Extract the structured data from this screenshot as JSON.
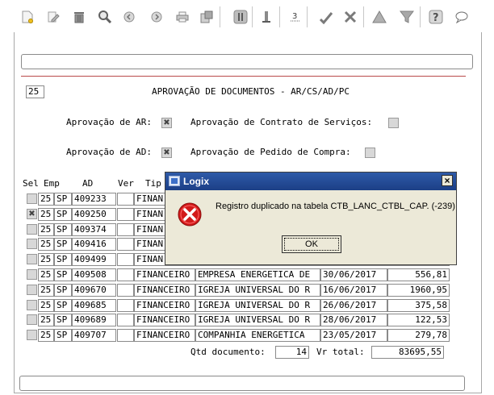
{
  "toolbar": {
    "icons": [
      "new-document-icon",
      "edit-icon",
      "trash-icon",
      "search-icon",
      "previous-icon",
      "next-icon",
      "print-icon",
      "export-icon",
      "first-icon",
      "last-icon",
      "page-icon",
      "approve-icon",
      "tools-icon",
      "warning-icon",
      "filter-icon",
      "help-icon",
      "chat-icon"
    ]
  },
  "form": {
    "code": "25",
    "title": "APROVAÇÃO DE DOCUMENTOS - AR/CS/AD/PC",
    "approval_ar_label": "Aprovação de AR:",
    "approval_ar_checked": true,
    "approval_cs_label": "Aprovação de Contrato de Serviços:",
    "approval_cs_checked": false,
    "approval_ad_label": "Aprovação de AD:",
    "approval_ad_checked": true,
    "approval_pc_label": "Aprovação de Pedido de Compra:",
    "approval_pc_checked": false
  },
  "table": {
    "headers": {
      "sel": "Sel",
      "emp": "Emp",
      "ad": "AD",
      "ver": "Ver",
      "tip": "Tip"
    },
    "rows": [
      {
        "sel": false,
        "emp": "25",
        "uf": "SP",
        "ad": "409233",
        "ver": "",
        "tipo": "FINAN",
        "fornecedor": "",
        "data": "",
        "valor": ""
      },
      {
        "sel": true,
        "emp": "25",
        "uf": "SP",
        "ad": "409250",
        "ver": "",
        "tipo": "FINAN",
        "fornecedor": "",
        "data": "",
        "valor": ""
      },
      {
        "sel": false,
        "emp": "25",
        "uf": "SP",
        "ad": "409374",
        "ver": "",
        "tipo": "FINAN",
        "fornecedor": "",
        "data": "",
        "valor": ""
      },
      {
        "sel": false,
        "emp": "25",
        "uf": "SP",
        "ad": "409416",
        "ver": "",
        "tipo": "FINAN",
        "fornecedor": "",
        "data": "",
        "valor": ""
      },
      {
        "sel": false,
        "emp": "25",
        "uf": "SP",
        "ad": "409499",
        "ver": "",
        "tipo": "FINAN",
        "fornecedor": "",
        "data": "",
        "valor": ""
      },
      {
        "sel": false,
        "emp": "25",
        "uf": "SP",
        "ad": "409508",
        "ver": "",
        "tipo": "FINANCEIRO",
        "fornecedor": "EMPRESA ENERGETICA DE",
        "data": "30/06/2017",
        "valor": "556,81"
      },
      {
        "sel": false,
        "emp": "25",
        "uf": "SP",
        "ad": "409670",
        "ver": "",
        "tipo": "FINANCEIRO",
        "fornecedor": "IGREJA UNIVERSAL DO R",
        "data": "16/06/2017",
        "valor": "1960,95"
      },
      {
        "sel": false,
        "emp": "25",
        "uf": "SP",
        "ad": "409685",
        "ver": "",
        "tipo": "FINANCEIRO",
        "fornecedor": "IGREJA UNIVERSAL DO R",
        "data": "26/06/2017",
        "valor": "375,58"
      },
      {
        "sel": false,
        "emp": "25",
        "uf": "SP",
        "ad": "409689",
        "ver": "",
        "tipo": "FINANCEIRO",
        "fornecedor": "IGREJA UNIVERSAL DO R",
        "data": "28/06/2017",
        "valor": "122,53"
      },
      {
        "sel": false,
        "emp": "25",
        "uf": "SP",
        "ad": "409707",
        "ver": "",
        "tipo": "FINANCEIRO",
        "fornecedor": "COMPANHIA ENERGETICA",
        "data": "23/05/2017",
        "valor": "279,78"
      }
    ]
  },
  "totals": {
    "qtd_label": "Qtd documento:",
    "qtd_value": "14",
    "vr_label": "Vr total:",
    "vr_value": "83695,55"
  },
  "dialog": {
    "title": "Logix",
    "message": "Registro duplicado na tabela CTB_LANC_CTBL_CAP. (-239)",
    "ok_label": "OK",
    "close_label": "×"
  }
}
